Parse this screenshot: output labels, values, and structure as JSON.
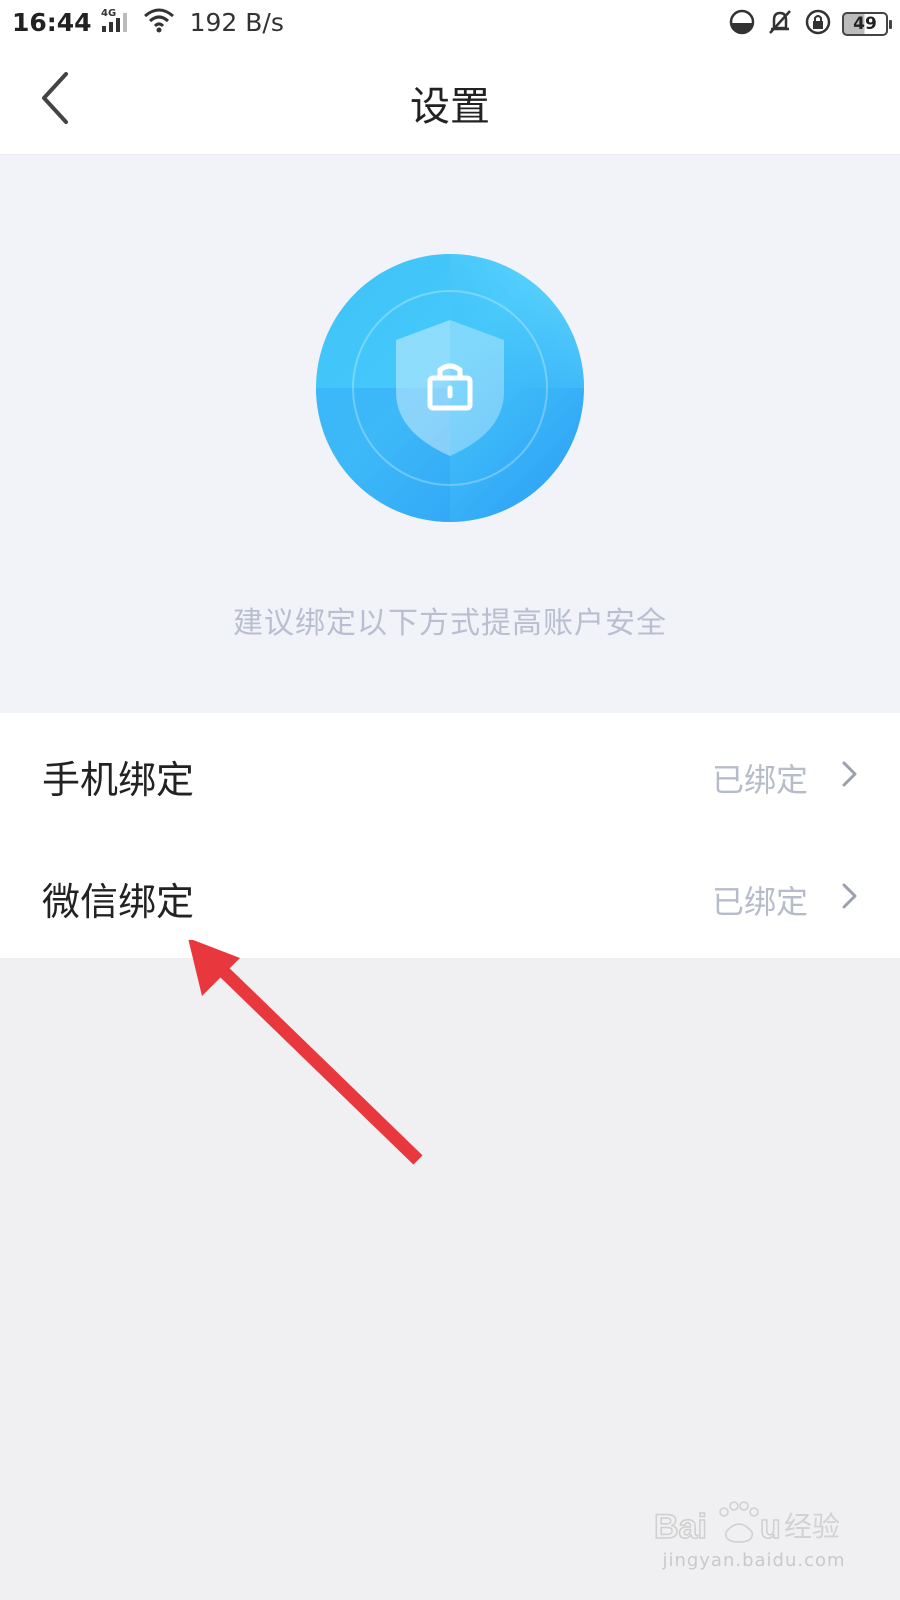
{
  "status_bar": {
    "time": "16:44",
    "network_type": "4G",
    "speed": "192 B/s",
    "battery_level": "49",
    "icons": [
      "signal-icon",
      "wifi-icon",
      "data-saver-icon",
      "mute-bell-icon",
      "rotation-lock-icon",
      "battery-icon"
    ]
  },
  "header": {
    "title": "设置",
    "back_icon": "chevron-left-icon"
  },
  "hero": {
    "icon": "shield-lock-icon",
    "hint": "建议绑定以下方式提高账户安全",
    "colors": {
      "circle_light": "#7ae7ff",
      "circle_dark": "#2b9bf4",
      "background": "#f2f3f8"
    }
  },
  "bindings": [
    {
      "label": "手机绑定",
      "status": "已绑定"
    },
    {
      "label": "微信绑定",
      "status": "已绑定"
    }
  ],
  "annotation": {
    "arrow_color": "#e8383d"
  },
  "watermark": {
    "logo_text": "Baidu经验",
    "url": "jingyan.baidu.com"
  }
}
